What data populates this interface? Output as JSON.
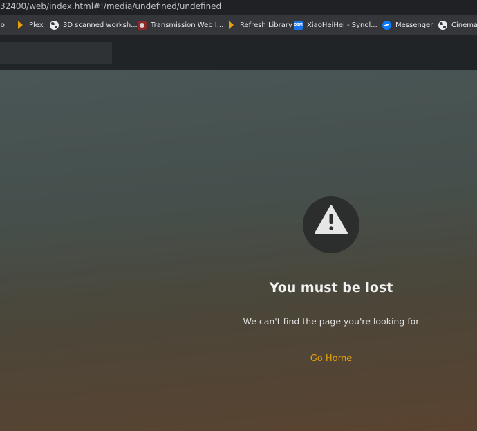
{
  "browser": {
    "url": "32400/web/index.html#!/media/undefined/undefined",
    "bookmarks": [
      {
        "label": "lo",
        "icon": "plex-icon"
      },
      {
        "label": "Plex",
        "icon": "plex-icon"
      },
      {
        "label": "3D scanned worksh...",
        "icon": "globe-icon"
      },
      {
        "label": "Transmission Web I...",
        "icon": "transmission-icon"
      },
      {
        "label": "Refresh Library",
        "icon": "plex-icon"
      },
      {
        "label": "XiaoHeiHei - Synol...",
        "icon": "dsm-icon"
      },
      {
        "label": "Messenger",
        "icon": "messenger-icon"
      },
      {
        "label": "Cinema -",
        "icon": "globe-icon"
      }
    ]
  },
  "error": {
    "icon": "warning-icon",
    "title": "You must be lost",
    "message": "We can't find the page you're looking for",
    "action_label": "Go Home"
  },
  "colors": {
    "accent": "#e5a00d",
    "header_bg": "#212426"
  }
}
